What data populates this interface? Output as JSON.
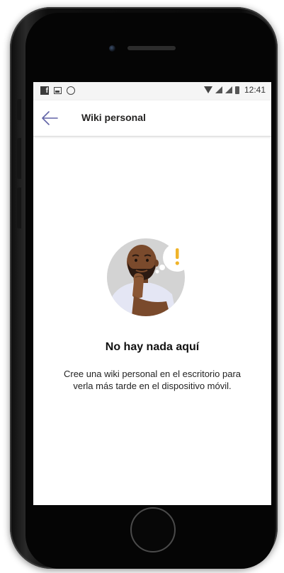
{
  "status_bar": {
    "time": "12:41",
    "left_icons": [
      "facebook-icon",
      "gallery-icon",
      "whatsapp-icon"
    ],
    "right_icons": [
      "wifi-icon",
      "signal-icon",
      "signal-icon",
      "battery-icon"
    ]
  },
  "app_bar": {
    "title": "Wiki personal",
    "back_icon": "arrow-left-icon"
  },
  "empty_state": {
    "title": "No hay nada aquí",
    "description": "Cree una wiki personal en el escritorio para verla más tarde en el dispositivo móvil."
  },
  "colors": {
    "accent": "#6264a7",
    "alert": "#f0b429",
    "skin": "#7a4a2c",
    "circle": "#d3d3d3"
  }
}
